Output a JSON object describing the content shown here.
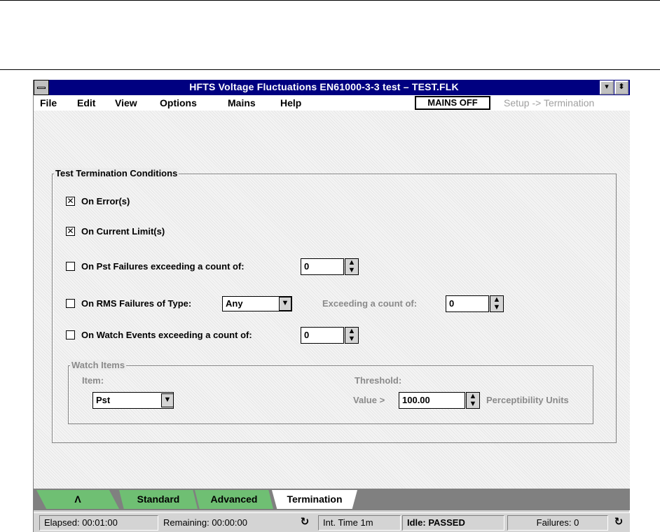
{
  "window": {
    "title": "HFTS Voltage Fluctuations EN61000-3-3 test – TEST.FLK",
    "minimize_glyph": "▾",
    "restore_glyph": "⬍"
  },
  "menubar": {
    "items": [
      {
        "label": "File",
        "underline": "F"
      },
      {
        "label": "Edit",
        "underline": "E"
      },
      {
        "label": "View",
        "underline": "V"
      },
      {
        "label": "Options",
        "underline": "O"
      },
      {
        "label": "Mains",
        "underline": "M"
      },
      {
        "label": "Help",
        "underline": "H"
      }
    ],
    "mains_status": "MAINS OFF",
    "breadcrumb": "Setup -> Termination"
  },
  "termination": {
    "group_title": "Test Termination Conditions",
    "on_error": {
      "label": "On Error(s)",
      "checked": true,
      "mark": "✕"
    },
    "on_current_limit": {
      "label": "On Current Limit(s)",
      "checked": true,
      "mark": "✕"
    },
    "on_pst": {
      "label": "On Pst Failures exceeding a count of:",
      "checked": false,
      "value": "0"
    },
    "on_rms": {
      "label": "On RMS Failures of Type:",
      "checked": false,
      "type_value": "Any",
      "exceed_label": "Exceeding a count of:",
      "value": "0"
    },
    "on_watch": {
      "label": "On Watch Events exceeding a count of:",
      "checked": false,
      "value": "0"
    }
  },
  "watch_items": {
    "group_title": "Watch Items",
    "item_label": "Item:",
    "item_value": "Pst",
    "threshold_label": "Threshold:",
    "value_label": "Value >",
    "threshold_value": "100.00",
    "units": "Perceptibility Units"
  },
  "tabs": [
    {
      "label": "Λ",
      "active": false
    },
    {
      "label": "Standard",
      "active": false
    },
    {
      "label": "Advanced",
      "active": false
    },
    {
      "label": "Termination",
      "active": true
    }
  ],
  "status": {
    "elapsed": "Elapsed: 00:01:00",
    "remaining": "Remaining: 00:00:00",
    "int_time": "Int. Time 1m",
    "idle": "Idle: PASSED",
    "failures": "Failures: 0",
    "refresh_glyph": "↻"
  },
  "icons": {
    "spin_up": "▲",
    "spin_down": "▼",
    "dropdown": "▼"
  },
  "colors": {
    "titlebar": "#000080",
    "tab_inactive": "#6fbf73",
    "tab_active": "#ffffff"
  }
}
